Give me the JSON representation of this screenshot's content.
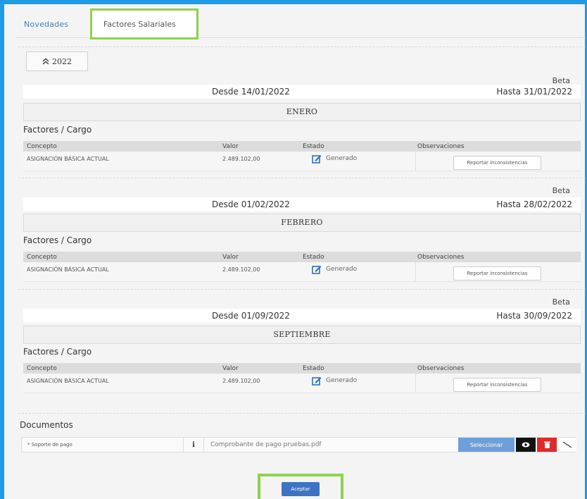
{
  "tabs": {
    "novedades": "Novedades",
    "factores": "Factores Salariales"
  },
  "year_button": {
    "icon": "chevron-double-up-icon",
    "label": "2022"
  },
  "periods": [
    {
      "beta": "Beta",
      "desde": "Desde 14/01/2022",
      "hasta": "Hasta 31/01/2022",
      "month": "ENERO",
      "subtitle": "Factores / Cargo",
      "headers": {
        "concepto": "Concepto",
        "valor": "Valor",
        "estado": "Estado",
        "observaciones": "Observaciones"
      },
      "row": {
        "concepto": "ASIGNACIÓN BÁSICA ACTUAL",
        "valor": "2.489.102,00",
        "estado": "Generado",
        "report": "Reportar inconsistencias"
      }
    },
    {
      "beta": "Beta",
      "desde": "Desde 01/02/2022",
      "hasta": "Hasta 28/02/2022",
      "month": "FEBRERO",
      "subtitle": "Factores / Cargo",
      "headers": {
        "concepto": "Concepto",
        "valor": "Valor",
        "estado": "Estado",
        "observaciones": "Observaciones"
      },
      "row": {
        "concepto": "ASIGNACIÓN BÁSICA ACTUAL",
        "valor": "2.489.102,00",
        "estado": "Generado",
        "report": "Reportar inconsistencias"
      }
    },
    {
      "beta": "Beta",
      "desde": "Desde 01/09/2022",
      "hasta": "Hasta 30/09/2022",
      "month": "SEPTIEMBRE",
      "subtitle": "Factores / Cargo",
      "headers": {
        "concepto": "Concepto",
        "valor": "Valor",
        "estado": "Estado",
        "observaciones": "Observaciones"
      },
      "row": {
        "concepto": "ASIGNACIÓN BÁSICA ACTUAL",
        "valor": "2.489.102,00",
        "estado": "Generado",
        "report": "Reportar inconsistencias"
      }
    }
  ],
  "documents": {
    "title": "Documentos",
    "soporte_label": "* Soporte de pago",
    "info_icon": "i",
    "file_name": "Comprobante de pago pruebas.pdf",
    "select_label": "Seleccionar"
  },
  "accept_label": "Aceptar",
  "colors": {
    "frame_blue": "#1e9be9",
    "highlight_green": "#8fd14f",
    "select_blue": "#6f9fd8",
    "accept_blue": "#3e73c4",
    "delete_red": "#e0292a",
    "edit_icon_blue": "#2f6fc4"
  }
}
